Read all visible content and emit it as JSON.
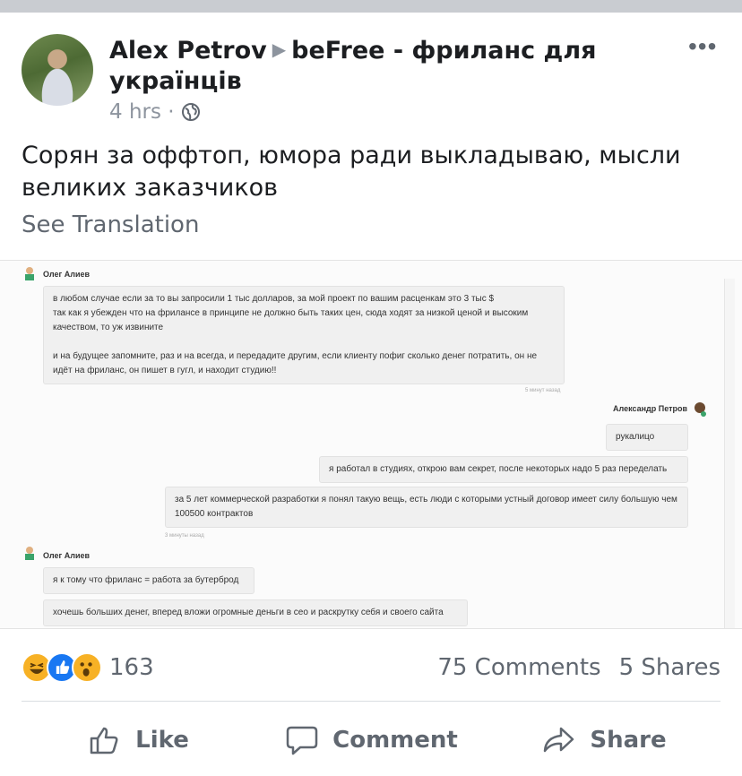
{
  "post": {
    "author": "Alex  Petrov",
    "group": "beFree - фриланс для українців",
    "time": "4 hrs ·",
    "text": "Сорян за оффтоп, юмора ради выкладываю, мысли великих заказчиков",
    "see_translation": "See Translation",
    "more_icon": "more-dots-icon",
    "privacy_icon": "globe-icon"
  },
  "screenshot": {
    "blocks": [
      {
        "author": "Олег Алиев"
      },
      {
        "author": "Александр Петров"
      },
      {
        "author": "Олег Алиев"
      }
    ],
    "messages": [
      "в любом случае если за то вы запросили 1 тыс долларов, за мой проект по вашим расценкам это 3 тыс $\nтак как я убежден что на фрилансе в принципе не должно быть таких цен, сюда ходят за низкой ценой и высоким качеством, то уж извините\n\nи на будущее запомните, раз и на всегда, и передадите другим, если клиенту пофиг сколько денег потратить, он не идёт на фриланс, он пишет в гугл, и находит студию!!",
      "рукалицо",
      "я работал в студиях, открою вам секрет, после некоторых надо 5 раз переделать",
      "за 5 лет коммерческой разработки я понял такую вещь, есть люди с которыми устный договор имеет силу большую чем 100500 контрактов",
      "я к тому что фриланс = работа за бутерброд",
      "хочешь больших денег, вперед вложи огромные деньги в сео и раскрутку себя и своего сайта"
    ],
    "times": [
      "5 минут назад",
      "3 минуты назад"
    ]
  },
  "engagement": {
    "reaction_count": "163",
    "comments": "75 Comments",
    "shares": "5 Shares",
    "reactions": [
      "haha-icon",
      "like-icon",
      "wow-icon"
    ]
  },
  "actions": {
    "like": "Like",
    "comment": "Comment",
    "share": "Share"
  },
  "colors": {
    "like_blue": "#1877f2",
    "reaction_yellow": "#f7b125",
    "secondary_text": "#606770"
  }
}
